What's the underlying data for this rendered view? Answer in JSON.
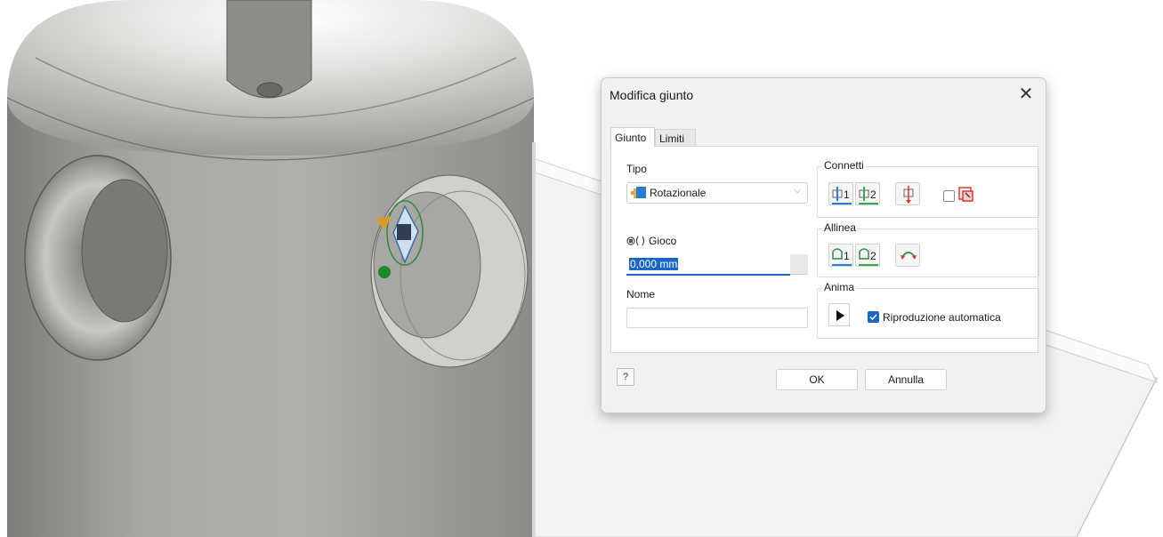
{
  "dialog": {
    "title": "Modifica giunto",
    "close_glyph": "✕",
    "tabs": [
      {
        "label": "Giunto",
        "active": true
      },
      {
        "label": "Limiti",
        "active": false
      }
    ],
    "tipo": {
      "label": "Tipo",
      "value": "Rotazionale",
      "icon": "rotational-joint-icon"
    },
    "gioco": {
      "label": "Gioco",
      "value": "0,000 mm",
      "icon": "gap-icon"
    },
    "nome": {
      "label": "Nome",
      "value": ""
    },
    "connetti": {
      "label": "Connetti",
      "buttons": [
        {
          "icon": "select-origin-1-icon",
          "number": "1",
          "underline_color": "#2a7bd6"
        },
        {
          "icon": "select-origin-2-icon",
          "number": "2",
          "underline_color": "#3aa84a"
        },
        {
          "icon": "flip-component-icon"
        }
      ],
      "lock_icon": "lock-component-icon"
    },
    "allinea": {
      "label": "Allinea",
      "buttons": [
        {
          "icon": "align-1-icon",
          "number": "1",
          "underline_color": "#2a7bd6"
        },
        {
          "icon": "align-2-icon",
          "number": "2",
          "underline_color": "#3aa84a"
        },
        {
          "icon": "invert-alignment-icon"
        }
      ]
    },
    "anima": {
      "label": "Anima",
      "play_icon": "play-icon",
      "autoplay_label": "Riproduzione automatica",
      "autoplay_checked": true
    },
    "help_glyph": "?",
    "ok_label": "OK",
    "cancel_label": "Annulla"
  },
  "colors": {
    "accent": "#1a66c9",
    "metal_body": "#a8a6a2",
    "plate": "#f2f2f2"
  }
}
